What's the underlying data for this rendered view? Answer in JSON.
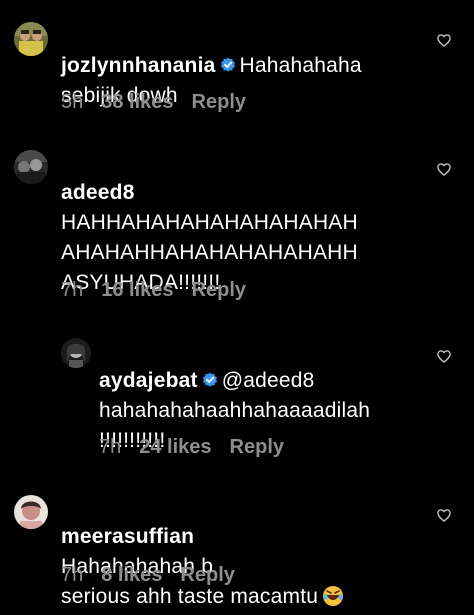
{
  "comments": [
    {
      "username": "jozlynnhanania",
      "verified": true,
      "text": "Hahahahaha\nsebijik dowh",
      "time": "5h",
      "likes": "38 likes",
      "reply": "Reply"
    },
    {
      "username": "adeed8",
      "verified": false,
      "text": "HAHHAHAHAHAHAHAHAHAH\nAHAHAHHAHAHAHAHAHAHH\nASYUHADA!!!!!!!",
      "time": "7h",
      "likes": "16 likes",
      "reply": "Reply"
    },
    {
      "username": "aydajebat",
      "verified": true,
      "text": "@adeed8\nhahahahahaahhahaaaadilah\n!!!!!!!!!!!",
      "time": "7h",
      "likes": "24 likes",
      "reply": "Reply"
    },
    {
      "username": "meerasuffian",
      "verified": false,
      "text": "Hahahahahah b\nserious ahh taste macamtu",
      "emoji": "rolling-on-floor-laughing",
      "time": "7h",
      "likes": "8 likes",
      "reply": "Reply"
    }
  ],
  "colors": {
    "background": "#000000",
    "text": "#ffffff",
    "meta": "#8e8e8e",
    "verified": "#3897f0"
  }
}
